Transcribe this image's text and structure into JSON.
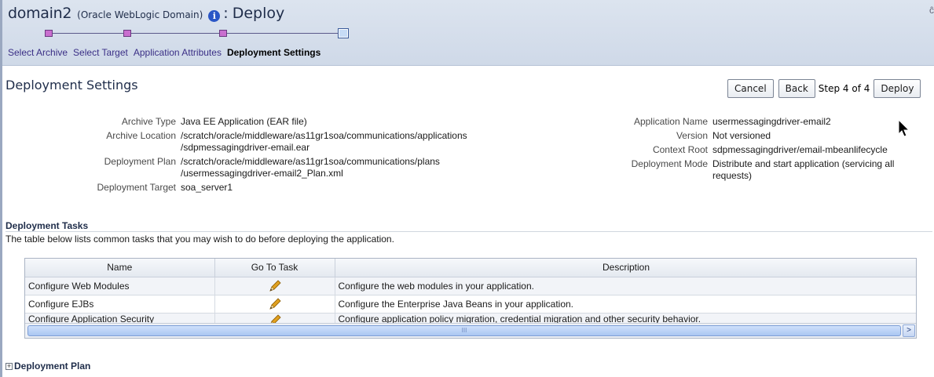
{
  "header": {
    "domain_name": "domain2",
    "domain_type": "(Oracle WebLogic Domain)",
    "colon": ":",
    "page_name": "Deploy",
    "info_glyph": "i",
    "right_mark": "ĉ"
  },
  "train": {
    "steps": [
      "Select Archive",
      "Select Target",
      "Application Attributes",
      "Deployment Settings"
    ],
    "current_index": 3
  },
  "page": {
    "title": "Deployment Settings"
  },
  "toolbar": {
    "cancel_label": "Cancel",
    "back_label": "Back",
    "step_text": "Step 4 of 4",
    "deploy_label": "Deploy"
  },
  "properties_left": [
    {
      "label": "Archive Type",
      "value": "Java EE Application (EAR file)"
    },
    {
      "label": "Archive Location",
      "value": "/scratch/oracle/middleware/as11gr1soa/communications/applications\n/sdpmessagingdriver-email.ear"
    },
    {
      "label": "Deployment Plan",
      "value": "/scratch/oracle/middleware/as11gr1soa/communications/plans\n/usermessagingdriver-email2_Plan.xml"
    },
    {
      "label": "Deployment Target",
      "value": "soa_server1"
    }
  ],
  "properties_right": [
    {
      "label": "Application Name",
      "value": "usermessagingdriver-email2"
    },
    {
      "label": "Version",
      "value": "Not versioned"
    },
    {
      "label": "Context Root",
      "value": "sdpmessagingdriver/email-mbeanlifecycle"
    },
    {
      "label": "Deployment Mode",
      "value": "Distribute and start application (servicing all\nrequests)"
    }
  ],
  "tasks": {
    "heading": "Deployment Tasks",
    "description": "The table below lists common tasks that you may wish to do before deploying the application.",
    "columns": [
      "Name",
      "Go To Task",
      "Description"
    ],
    "rows": [
      {
        "name": "Configure Web Modules",
        "action_icon": "pencil-icon",
        "description": "Configure the web modules in your application."
      },
      {
        "name": "Configure EJBs",
        "action_icon": "pencil-icon",
        "description": "Configure the Enterprise Java Beans in your application."
      },
      {
        "name": "Configure Application Security",
        "action_icon": "pencil-icon",
        "description": "Configure application policy migration, credential migration and other security behavior."
      }
    ],
    "scroll_thumb_label": "III",
    "scroll_right_glyph": ">"
  },
  "plan": {
    "expand_glyph": "+",
    "heading": "Deployment Plan"
  },
  "colors": {
    "header_bg": "#d6dfeb",
    "link": "#3a2f86",
    "title": "#1f2d4a",
    "train_stop": "#c96fcf"
  }
}
